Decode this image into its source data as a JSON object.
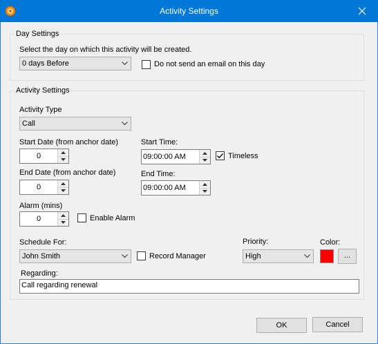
{
  "window": {
    "title": "Activity Settings"
  },
  "day_settings": {
    "legend": "Day Settings",
    "instruction": "Select the day on which this activity will be created.",
    "day_select": "0 days Before",
    "no_email_label": "Do not send an email on this day",
    "no_email_checked": false
  },
  "activity_settings": {
    "legend": "Activity Settings",
    "activity_type_label": "Activity Type",
    "activity_type": "Call",
    "start_date_label": "Start Date (from anchor date)",
    "start_date_value": "0",
    "end_date_label": "End Date (from anchor date)",
    "end_date_value": "0",
    "start_time_label": "Start Time:",
    "start_time_value": "09:00:00 AM",
    "timeless_label": "Timeless",
    "timeless_checked": true,
    "end_time_label": "End Time:",
    "end_time_value": "09:00:00 AM",
    "alarm_label": "Alarm (mins)",
    "alarm_value": "0",
    "enable_alarm_label": "Enable Alarm",
    "enable_alarm_checked": false,
    "schedule_for_label": "Schedule For:",
    "schedule_for": "John Smith",
    "record_manager_label": "Record Manager",
    "record_manager_checked": false,
    "priority_label": "Priority:",
    "priority": "High",
    "color_label": "Color:",
    "color_value": "#ff0000",
    "color_browse_label": "...",
    "regarding_label": "Regarding:",
    "regarding_value": "Call regarding renewal"
  },
  "buttons": {
    "ok": "OK",
    "cancel": "Cancel"
  }
}
